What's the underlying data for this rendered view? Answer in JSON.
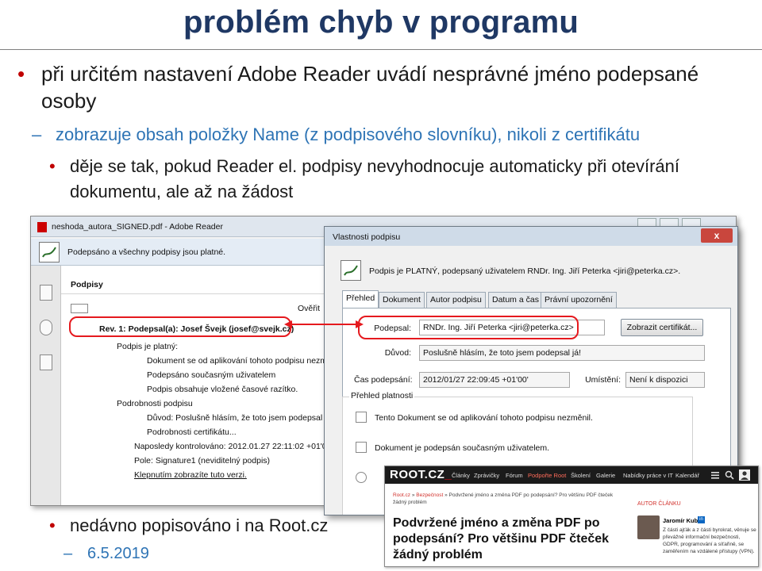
{
  "slide": {
    "title": "problém chyb v programu",
    "bullets": [
      "při určitém nastavení Adobe Reader uvádí nesprávné jméno podepsané osoby",
      "zobrazuje obsah položky Name (z podpisového slovníku), nikoli z certifikátu",
      "děje se tak, pokud Reader el. podpisy nevyhodnocuje automaticky při otevírání dokumentu, ale až na žádost",
      "nedávno popisováno i na Root.cz",
      "6.5.2019"
    ],
    "bullet_glyph": "•",
    "dash_glyph": "–"
  },
  "reader": {
    "window_title": "neshoda_autora_SIGNED.pdf - Adobe Reader",
    "signature_bar": "Podepsáno a všechny podpisy jsou platné.",
    "panel_title": "Podpisy",
    "verify_label": "Ověřit",
    "tree": {
      "rev": "Rev. 1: Podepsal(a): Josef Švejk (josef@svejk.cz)",
      "valid": "Podpis je platný:",
      "v1": "Dokument se od aplikování tohoto podpisu nezměnil",
      "v2": "Podepsáno současným uživatelem",
      "v3": "Podpis obsahuje vložené časové razítko.",
      "details": "Podrobnosti podpisu",
      "reason": "Důvod: Poslušně hlásím, že toto jsem podepsal já!",
      "cert": "Podrobnosti certifikátu...",
      "last": "Naposledy kontrolováno: 2012.01.27 22:11:02 +01'00'",
      "field": "Pole: Signature1 (neviditelný podpis)",
      "click": "Klepnutím zobrazíte tuto verzi."
    }
  },
  "dialog": {
    "title": "Vlastnosti podpisu",
    "close": "x",
    "status": "Podpis je PLATNÝ, podepsaný uživatelem RNDr. Ing. Jiří Peterka <jiri@peterka.cz>.",
    "tabs": [
      "Přehled",
      "Dokument",
      "Autor podpisu",
      "Datum a čas",
      "Právní upozornění"
    ],
    "signer_label": "Podepsal:",
    "signer_value": "RNDr. Ing. Jiří Peterka <jiri@peterka.cz>",
    "show_cert_button": "Zobrazit certifikát...",
    "reason_label": "Důvod:",
    "reason_value": "Poslušně hlásím, že toto jsem podepsal já!",
    "time_label": "Čas podepsání:",
    "time_value": "2012/01/27 22:09:45 +01'00'",
    "location_label": "Umístění:",
    "location_value": "Není k dispozici",
    "validity_group": "Přehled platnosti",
    "validity_items": [
      "Tento Dokument se od aplikování tohoto podpisu nezměnil.",
      "Dokument je podepsán současným uživatelem."
    ]
  },
  "root": {
    "logo": "ROOT.CZ",
    "nav": [
      "Články",
      "Zprávičky",
      "Fórum",
      "Podpořte Root",
      "Školení",
      "Galerie",
      "Nabídky práce v IT",
      "Kalendář"
    ],
    "breadcrumb_links": [
      "Root.cz",
      "Bezpečnost"
    ],
    "breadcrumb_rest": "» Podvržené jméno a změna PDF po podepsání? Pro většinu PDF čteček žádný problém",
    "headline": "Podvržené jméno a změna PDF po podepsání? Pro většinu PDF čteček žádný problém",
    "sidebar_title": "AUTOR ČLÁNKU",
    "author": "Jaromír Kuba",
    "linkedin": "in",
    "bio": "Z části ajťák a z části byrokrat, věnuje se převážně informační bezpečnosti, GDPR, programování a síťařině, se zaměřením na vzdálené přístupy (VPN).",
    "icons": [
      "menu-icon",
      "search-icon",
      "user-icon"
    ]
  },
  "colors": {
    "title": "#1f3864",
    "bullet": "#c00000",
    "sub_bullet": "#2e74b5",
    "highlight": "#e5191e",
    "root_accent": "#d2312c"
  }
}
